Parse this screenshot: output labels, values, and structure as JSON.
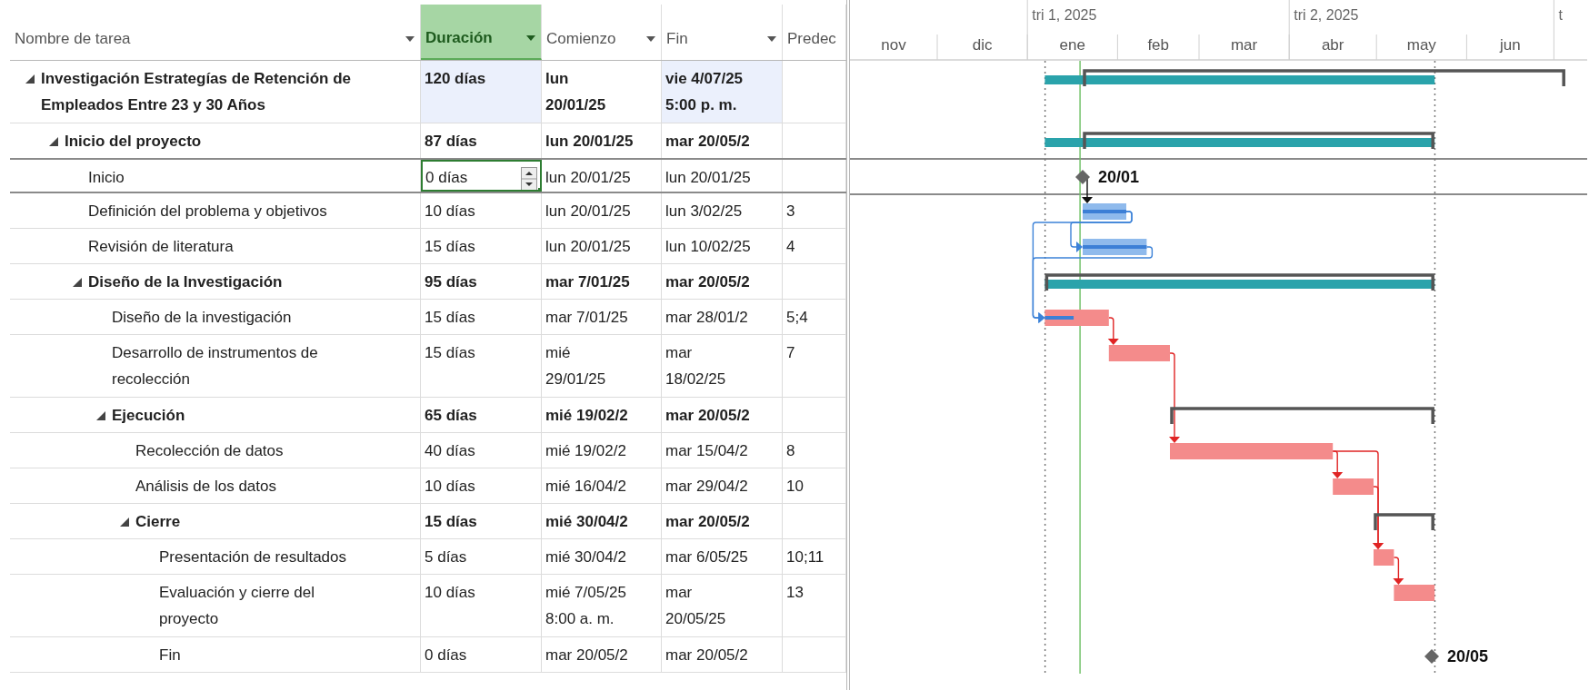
{
  "columns": [
    {
      "label": "Nombre de tarea",
      "selected": false,
      "menu": true
    },
    {
      "label": "Duración",
      "selected": true,
      "menu": true
    },
    {
      "label": "Comienzo",
      "selected": false,
      "menu": true
    },
    {
      "label": "Fin",
      "selected": false,
      "menu": true
    },
    {
      "label": "Predec",
      "selected": false,
      "menu": false
    }
  ],
  "tasks": [
    {
      "name": "Investigación Estrategías de Retención de\nEmpleados Entre 23 y 30 Años",
      "kind": "summary",
      "expanded": true,
      "selected": false,
      "duration": "120 días",
      "duration_changed": true,
      "start": "lun\n20/01/25",
      "finish": "vie 4/07/25\n5:00 p. m.",
      "finish_changed": true,
      "rollup": true,
      "children": [
        {
          "name": "Inicio del proyecto",
          "kind": "summary",
          "expanded": true,
          "selected": false,
          "duration": "87 días",
          "start": "lun 20/01/25",
          "finish": "mar 20/05/2",
          "rollup": true,
          "children": [
            {
              "name": "Inicio",
              "kind": "milestone",
              "selected": true,
              "duration": "0 días",
              "start": "lun 20/01/25",
              "finish": "lun 20/01/25",
              "bar_label": "20/01"
            },
            {
              "name": "Definición del problema y objetivos",
              "kind": "task",
              "critical": false,
              "selected": false,
              "duration": "10 días",
              "start": "lun 20/01/25",
              "finish": "lun 3/02/25",
              "predecessors": "3",
              "level": 1
            },
            {
              "name": "Revisión de literatura",
              "kind": "task",
              "critical": false,
              "selected": false,
              "duration": "15 días",
              "start": "lun 20/01/25",
              "finish": "lun 10/02/25",
              "predecessors": "4",
              "level": 1
            },
            {
              "name": "Diseño de la Investigación",
              "kind": "summary",
              "expanded": true,
              "selected": false,
              "duration": "95 días",
              "start": "mar 7/01/25",
              "finish": "mar 20/05/2",
              "rollup": true,
              "children": [
                {
                  "name": "Diseño de la investigación",
                  "kind": "task",
                  "critical": true,
                  "selected": false,
                  "duration": "15 días",
                  "start": "mar 7/01/25",
                  "finish": "mar 28/01/2",
                  "predecessors": "5;4",
                  "level": 0.45
                },
                {
                  "name": "Desarrollo de instrumentos de\nrecolección",
                  "kind": "task",
                  "critical": true,
                  "selected": false,
                  "duration": "15 días",
                  "start": "mié\n29/01/25",
                  "finish": "mar\n18/02/25",
                  "predecessors": "7"
                },
                {
                  "name": "Ejecución",
                  "kind": "summary",
                  "expanded": true,
                  "selected": false,
                  "duration": "65 días",
                  "start": "mié 19/02/2",
                  "finish": "mar 20/05/2",
                  "rollup": false,
                  "children": [
                    {
                      "name": "Recolección de datos",
                      "kind": "task",
                      "critical": true,
                      "selected": false,
                      "duration": "40 días",
                      "start": "mié 19/02/2",
                      "finish": "mar 15/04/2",
                      "predecessors": "8"
                    },
                    {
                      "name": "Análisis de los datos",
                      "kind": "task",
                      "critical": true,
                      "selected": false,
                      "duration": "10 días",
                      "start": "mié 16/04/2",
                      "finish": "mar 29/04/2",
                      "predecessors": "10"
                    },
                    {
                      "name": "Cierre",
                      "kind": "summary",
                      "expanded": true,
                      "selected": false,
                      "duration": "15 días",
                      "start": "mié 30/04/2",
                      "finish": "mar 20/05/2",
                      "rollup": false,
                      "children": [
                        {
                          "name": "Presentación de resultados",
                          "kind": "task",
                          "critical": true,
                          "selected": false,
                          "duration": "5 días",
                          "start": "mié 30/04/2",
                          "finish": "mar 6/05/25",
                          "predecessors": "10;11"
                        },
                        {
                          "name": "Evaluación y cierre del\nproyecto",
                          "kind": "task",
                          "critical": true,
                          "selected": false,
                          "duration": "10 días",
                          "start": "mié 7/05/25\n8:00 a. m.",
                          "finish": "mar\n20/05/25",
                          "predecessors": "13"
                        },
                        {
                          "name": "Fin",
                          "kind": "milestone",
                          "selected": false,
                          "duration": "0 días",
                          "start": "mar 20/05/2",
                          "finish": "mar 20/05/2",
                          "bar_label": "20/05"
                        }
                      ]
                    }
                  ]
                }
              ]
            }
          ]
        }
      ]
    }
  ],
  "timescale": {
    "quarters": [
      {
        "months": [
          {
            "label": "nov"
          },
          {
            "label": "dic"
          }
        ]
      },
      {
        "label": "tri 1, 2025",
        "months": [
          {
            "label": "ene"
          },
          {
            "label": "feb"
          },
          {
            "label": "mar"
          }
        ]
      },
      {
        "label": "tri 2, 2025",
        "months": [
          {
            "label": "abr"
          },
          {
            "label": "may"
          },
          {
            "label": "jun"
          }
        ]
      },
      {
        "label": "t"
      }
    ]
  },
  "current_date_line": true,
  "project_bounds": true
}
